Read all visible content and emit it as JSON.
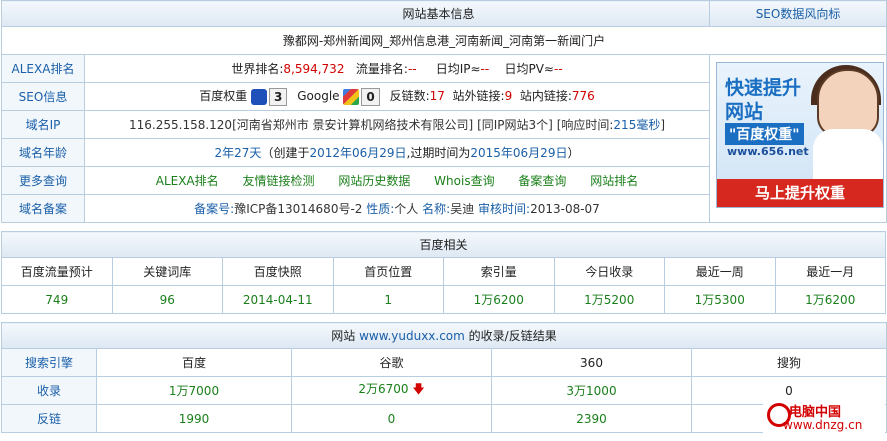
{
  "header": {
    "title": "网站基本信息",
    "seo_link": "SEO数据风向标"
  },
  "site_title": "豫都网-郑州新闻网_郑州信息港_河南新闻_河南第一新闻门户",
  "alexa": {
    "label": "ALEXA排名",
    "world_rank_label": "世界排名:",
    "world_rank": "8,594,732",
    "traffic_rank_label": "流量排名:",
    "traffic_rank": "--",
    "daily_ip_label": "日均IP≈",
    "daily_ip": "--",
    "daily_pv_label": "日均PV≈",
    "daily_pv": "--"
  },
  "seo": {
    "label": "SEO信息",
    "baidu_label": "百度权重",
    "baidu_weight": "3",
    "google_label": "Google",
    "google_pr": "0",
    "backlinks_label": "反链数:",
    "backlinks": "17",
    "external_label": "站外链接:",
    "external": "9",
    "internal_label": "站内链接:",
    "internal": "776"
  },
  "domain_ip": {
    "label": "域名IP",
    "ip": "116.255.158.120",
    "location": "[河南省郑州市 景安计算机网络技术有限公司]",
    "same_ip": "[同IP网站3个]",
    "resp_label": "[响应时间:",
    "resp": "215毫秒",
    "resp_end": "]"
  },
  "domain_age": {
    "label": "域名年龄",
    "age": "2年27天",
    "created_label": "（创建于",
    "created": "2012年06月29日",
    "expire_label": ",过期时间为",
    "expire": "2015年06月29日",
    "end": "）"
  },
  "more": {
    "label": "更多查询",
    "links": [
      "ALEXA排名",
      "友情链接检测",
      "网站历史数据",
      "Whois查询",
      "备案查询",
      "网站排名"
    ]
  },
  "icp": {
    "label": "域名备案",
    "no_label": "备案号:",
    "no": "豫ICP备13014680号-2",
    "nature_label": "性质:",
    "nature": "个人",
    "name_label": "名称:",
    "name": "吴迪",
    "date_label": "审核时间:",
    "date": "2013-08-07"
  },
  "ad": {
    "line1": "快速提升",
    "line2": "网站",
    "line3": "\"百度权重\"",
    "line4": "www.656.net",
    "button": "马上提升权重"
  },
  "baidu": {
    "title": "百度相关",
    "headers": [
      "百度流量预计",
      "关键词库",
      "百度快照",
      "首页位置",
      "索引量",
      "今日收录",
      "最近一周",
      "最近一月"
    ],
    "values": [
      "749",
      "96",
      "2014-04-11",
      "1",
      "1万6200",
      "1万5200",
      "1万5300",
      "1万6200"
    ]
  },
  "engines": {
    "title_prefix": "网站",
    "site": "www.yuduxx.com",
    "title_suffix": "的收录/反链结果",
    "headers": [
      "搜索引擎",
      "百度",
      "谷歌",
      "360",
      "搜狗"
    ],
    "index_label": "收录",
    "index": [
      "1万7000",
      "2万6700",
      "3万1000",
      "0"
    ],
    "backlink_label": "反链",
    "backlinks": [
      "1990",
      "0",
      "2390",
      "查询"
    ]
  },
  "watermark": {
    "name": "电脑中国",
    "url": "www.dnzg.cn"
  }
}
